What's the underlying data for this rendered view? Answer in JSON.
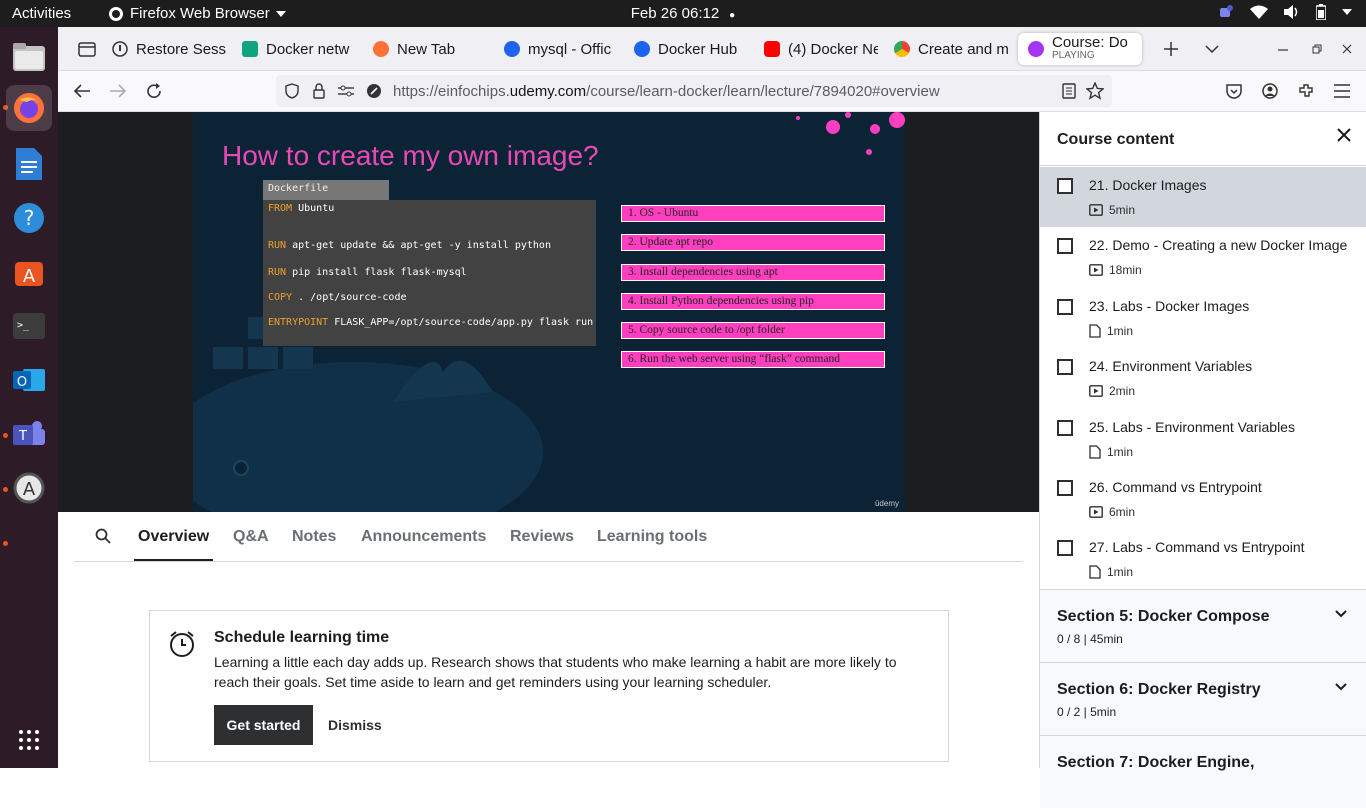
{
  "system": {
    "activities": "Activities",
    "app_name": "Firefox Web Browser",
    "clock": "Feb 26  06:12"
  },
  "browser": {
    "tabs": [
      {
        "label": "Restore Sess",
        "icon": "restore-icon"
      },
      {
        "label": "Docker netw",
        "icon": "chatgpt-icon"
      },
      {
        "label": "New Tab",
        "icon": "firefox-icon"
      },
      {
        "label": "mysql - Offic",
        "icon": "docker-icon"
      },
      {
        "label": "Docker Hub",
        "icon": "docker-icon"
      },
      {
        "label": "(4) Docker Ne",
        "icon": "youtube-icon"
      },
      {
        "label": "Create and m",
        "icon": "chrome-icon"
      }
    ],
    "active_tab": {
      "label": "Course: Do",
      "status": "PLAYING"
    },
    "url_prefix": "https://einfochips.",
    "url_domain": "udemy.com",
    "url_suffix": "/course/learn-docker/learn/lecture/7894020#overview"
  },
  "slide": {
    "title": "How to create my own image?",
    "file_label": "Dockerfile",
    "code": [
      {
        "kw": "FROM",
        "rest": " Ubuntu"
      },
      {
        "kw": "RUN",
        "rest": " apt-get update && apt-get -y install python"
      },
      {
        "kw": "RUN",
        "rest": " pip install flask flask-mysql"
      },
      {
        "kw": "COPY",
        "rest": " . /opt/source-code"
      },
      {
        "kw": "ENTRYPOINT",
        "rest": " FLASK_APP=/opt/source-code/app.py flask run"
      }
    ],
    "steps": [
      "1. OS - Ubuntu",
      "2. Update apt repo",
      "3. Install dependencies using apt",
      "4. Install Python dependencies using pip",
      "5. Copy source code to /opt folder",
      "6. Run the web server using “flask” command"
    ],
    "watermark": "ūdemy"
  },
  "lecture_tabs": [
    "Overview",
    "Q&A",
    "Notes",
    "Announcements",
    "Reviews",
    "Learning tools"
  ],
  "schedule": {
    "title": "Schedule learning time",
    "body": "Learning a little each day adds up. Research shows that students who make learning a habit are more likely to reach their goals. Set time aside to learn and get reminders using your learning scheduler.",
    "primary": "Get started",
    "secondary": "Dismiss"
  },
  "sidebar": {
    "title": "Course content",
    "lectures": [
      {
        "name": "21. Docker Images",
        "duration": "5min",
        "type": "video",
        "current": true
      },
      {
        "name": "22. Demo - Creating a new Docker Image",
        "duration": "18min",
        "type": "video"
      },
      {
        "name": "23. Labs - Docker Images",
        "duration": "1min",
        "type": "doc"
      },
      {
        "name": "24. Environment Variables",
        "duration": "2min",
        "type": "video"
      },
      {
        "name": "25. Labs - Environment Variables",
        "duration": "1min",
        "type": "doc"
      },
      {
        "name": "26. Command vs Entrypoint",
        "duration": "6min",
        "type": "video"
      },
      {
        "name": "27. Labs - Command vs Entrypoint",
        "duration": "1min",
        "type": "doc"
      }
    ],
    "sections": [
      {
        "title": "Section 5: Docker Compose",
        "meta": "0 / 8 | 45min"
      },
      {
        "title": "Section 6: Docker Registry",
        "meta": "0 / 2 | 5min"
      },
      {
        "title": "Section 7: Docker Engine,",
        "meta": ""
      }
    ]
  }
}
